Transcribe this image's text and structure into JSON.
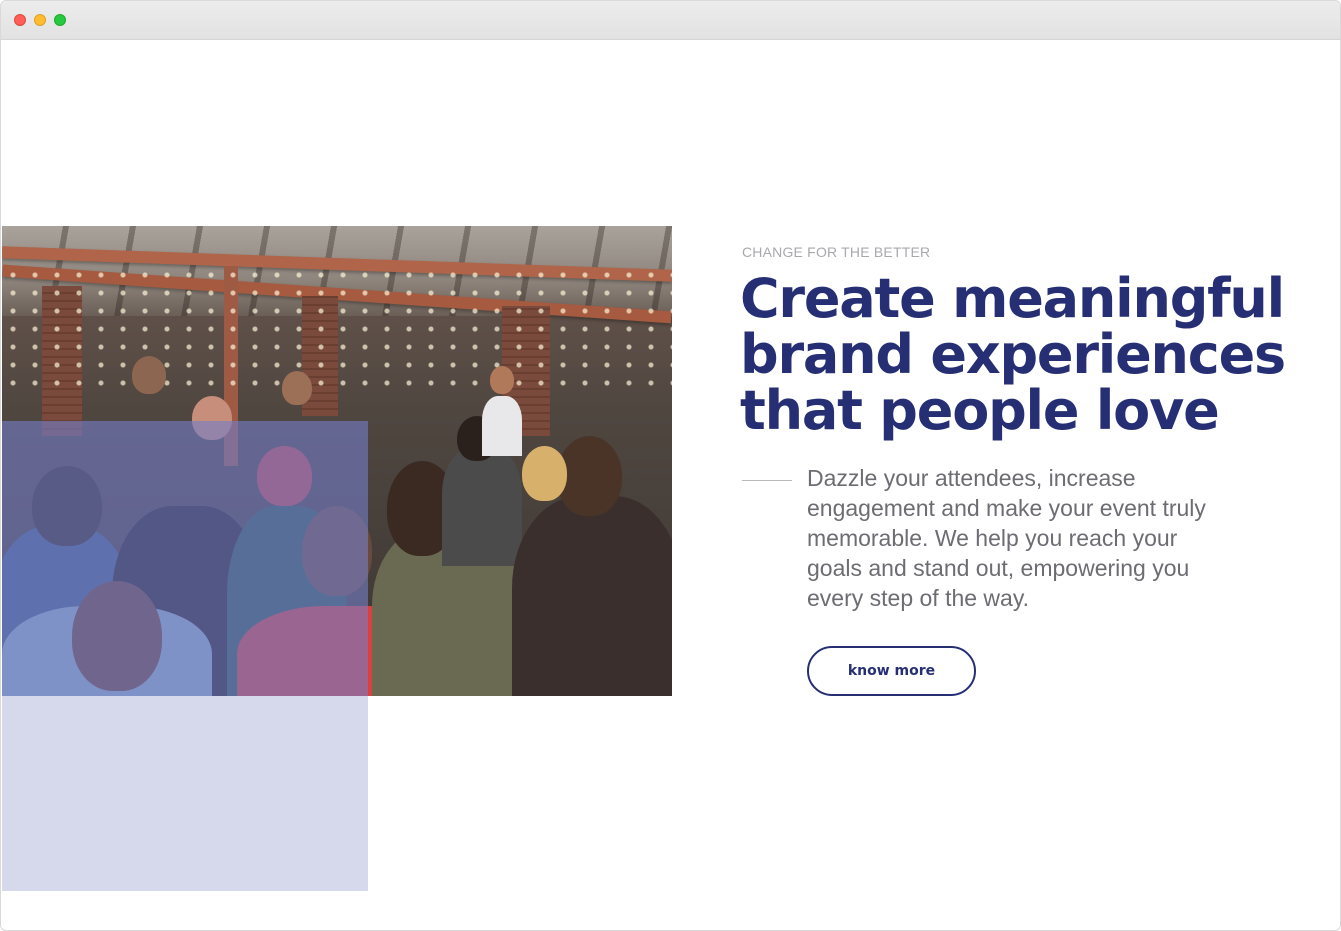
{
  "hero": {
    "eyebrow": "CHANGE FOR THE BETTER",
    "headline": "Create meaningful brand experiences that people love",
    "description": "Dazzle your attendees, increase engagement and make your event truly memorable. We help you reach your goals and stand out, empowering you every step of the way.",
    "cta_label": "know more"
  },
  "colors": {
    "brand_navy": "#262f74",
    "eyebrow_gray": "#a9a9ad",
    "body_gray": "#6c6c72",
    "overlay_lavender": "#848cc4"
  },
  "icons": {
    "window_controls": [
      "close-dot",
      "minimize-dot",
      "zoom-dot"
    ]
  }
}
